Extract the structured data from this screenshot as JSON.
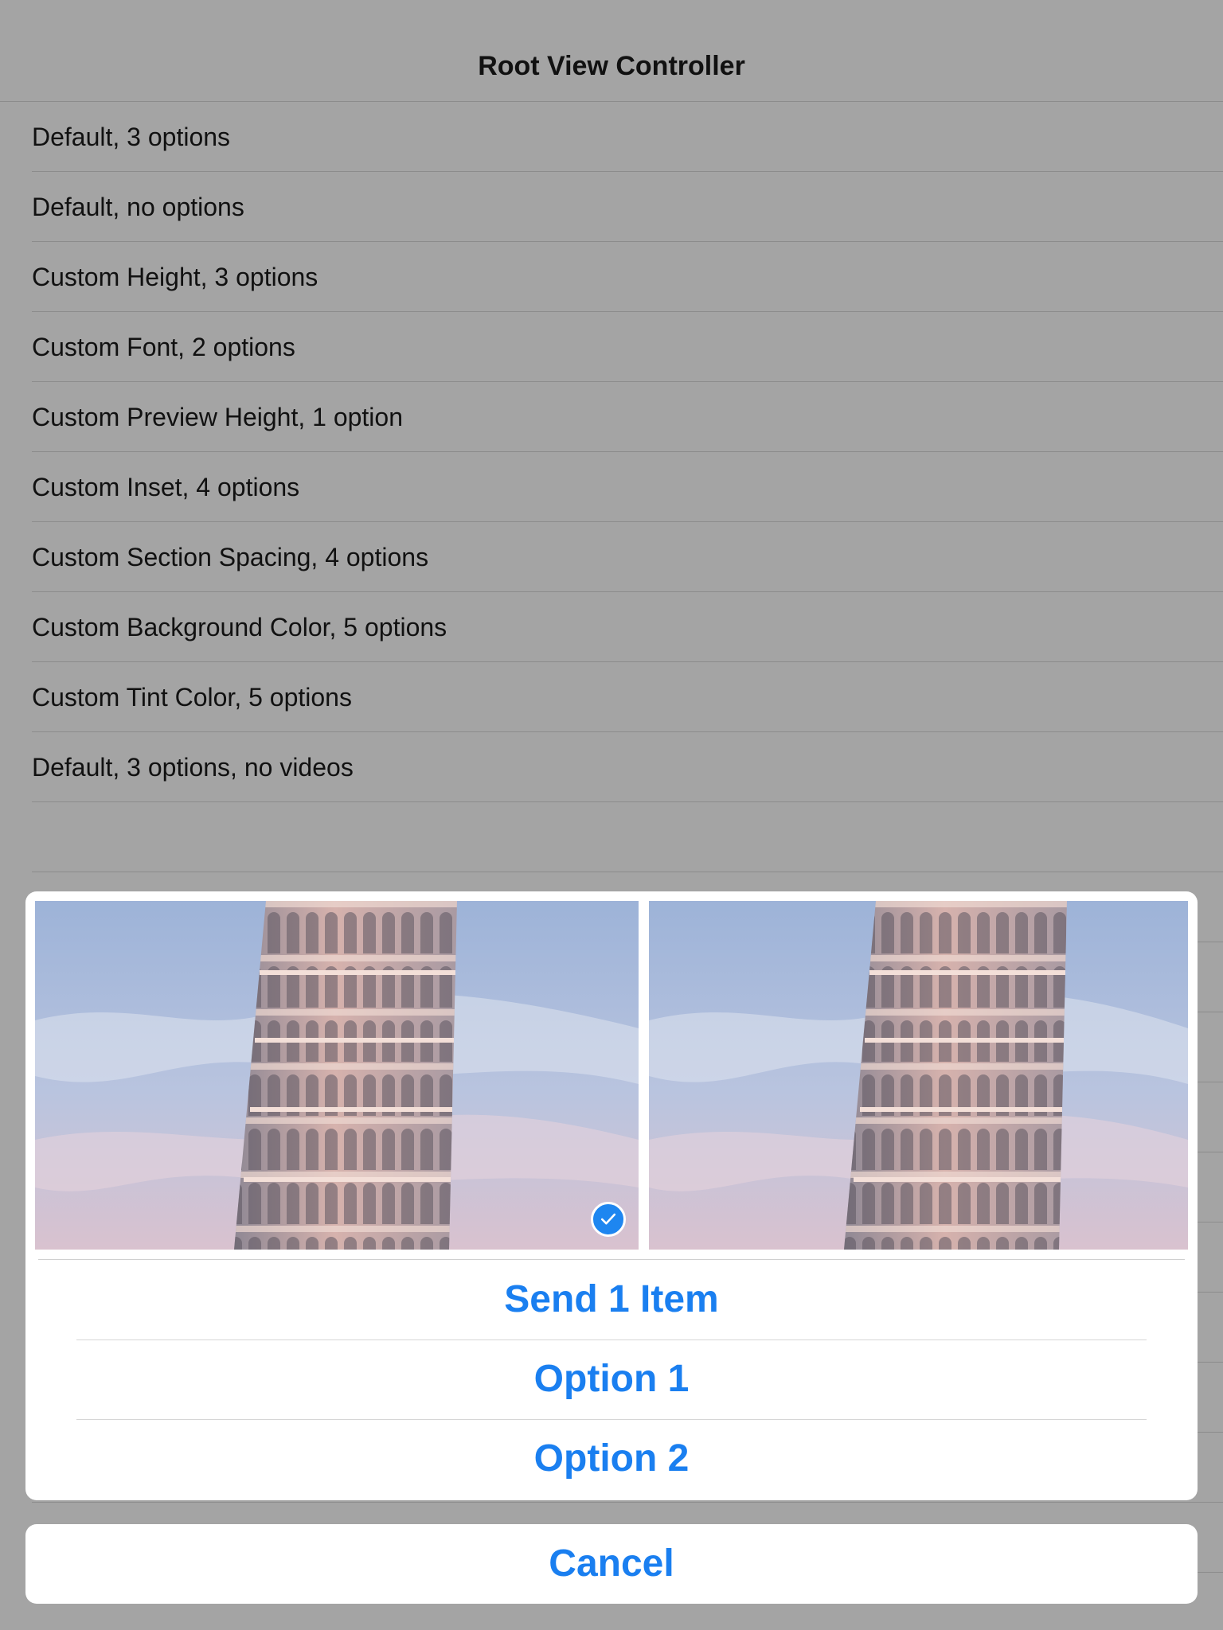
{
  "nav": {
    "title": "Root View Controller"
  },
  "table": {
    "rows": [
      {
        "label": "Default, 3 options"
      },
      {
        "label": "Default, no options"
      },
      {
        "label": "Custom Height, 3 options"
      },
      {
        "label": "Custom Font, 2 options"
      },
      {
        "label": "Custom Preview Height, 1 option"
      },
      {
        "label": "Custom Inset, 4 options"
      },
      {
        "label": "Custom Section Spacing, 4 options"
      },
      {
        "label": "Custom Background Color, 5 options"
      },
      {
        "label": "Custom Tint Color, 5 options"
      },
      {
        "label": "Default, 3 options, no videos"
      },
      {
        "label": ""
      }
    ]
  },
  "sheet": {
    "photos": [
      {
        "selected": true,
        "check_icon": "checkmark-circle-icon"
      },
      {
        "selected": false
      }
    ],
    "options": [
      {
        "label": "Send 1 Item"
      },
      {
        "label": "Option 1"
      },
      {
        "label": "Option 2"
      }
    ],
    "cancel_label": "Cancel"
  },
  "colors": {
    "tint": "#1a7ff0",
    "dimmed_background": "#a4a4a4",
    "sheet_background": "#ffffff"
  }
}
